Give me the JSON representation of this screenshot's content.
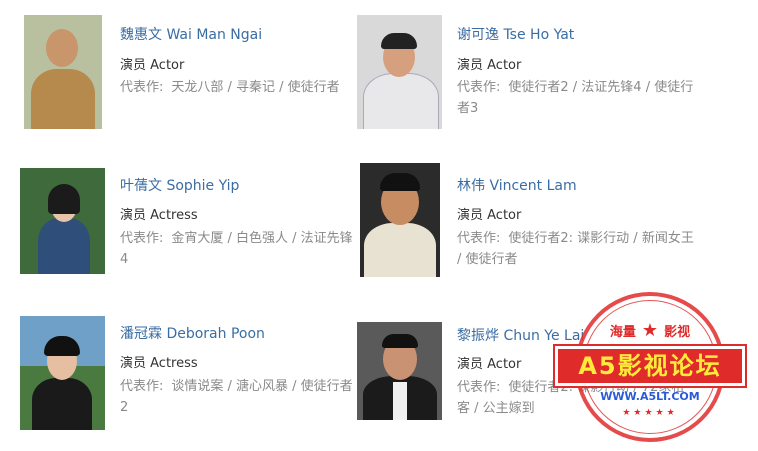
{
  "actors": [
    {
      "name": "魏惠文 Wai Man Ngai",
      "role": "演员 Actor",
      "works_label": "代表作:",
      "works": "天龙八部 / 寻秦记 / 使徒行者",
      "photo_colors": {
        "bg": "#b8c0a0",
        "head": "#c9956a",
        "body": "#b58a4c"
      }
    },
    {
      "name": "谢可逸 Tse Ho Yat",
      "role": "演员 Actor",
      "works_label": "代表作:",
      "works": "使徒行者2 / 法证先锋4 / 使徒行者3",
      "photo_colors": {
        "bg": "#d9d9d9",
        "head": "#d6a07e",
        "body": "#e8e8ea"
      }
    },
    {
      "name": "叶蒨文 Sophie Yip",
      "role": "演员 Actress",
      "works_label": "代表作:",
      "works": "金宵大厦 / 白色强人 / 法证先锋4",
      "photo_colors": {
        "bg": "#3f6a3b",
        "head": "#e8c4ab",
        "body": "#2f4f7a"
      }
    },
    {
      "name": "林伟 Vincent Lam",
      "role": "演员 Actor",
      "works_label": "代表作:",
      "works": "使徒行者2: 谍影行动 / 新闻女王 / 使徒行者",
      "photo_colors": {
        "bg": "#2b2b2b",
        "head": "#c78c62",
        "body": "#e7e2d2"
      }
    },
    {
      "name": "潘冠霖 Deborah Poon",
      "role": "演员 Actress",
      "works_label": "代表作:",
      "works": "谈情说案 / 溏心风暴 / 使徒行者2",
      "photo_colors": {
        "bg": "#6fa0c8",
        "head": "#e6bfa2",
        "body": "#1a1a1a"
      }
    },
    {
      "name": "黎振烨 Chun Ye Lai",
      "role": "演员 Actor",
      "works_label": "代表作:",
      "works": "使徒行者2: 谍影行动 / 72家租客 / 公主嫁到",
      "photo_colors": {
        "bg": "#5a5a5a",
        "head": "#c99272",
        "body": "#1b1b1b"
      }
    }
  ],
  "watermark": {
    "top_left": "海量",
    "top_right": "影视",
    "title": "A5影视论坛",
    "url": "WWW.A5LT.COM",
    "color": "#e02b2b"
  }
}
